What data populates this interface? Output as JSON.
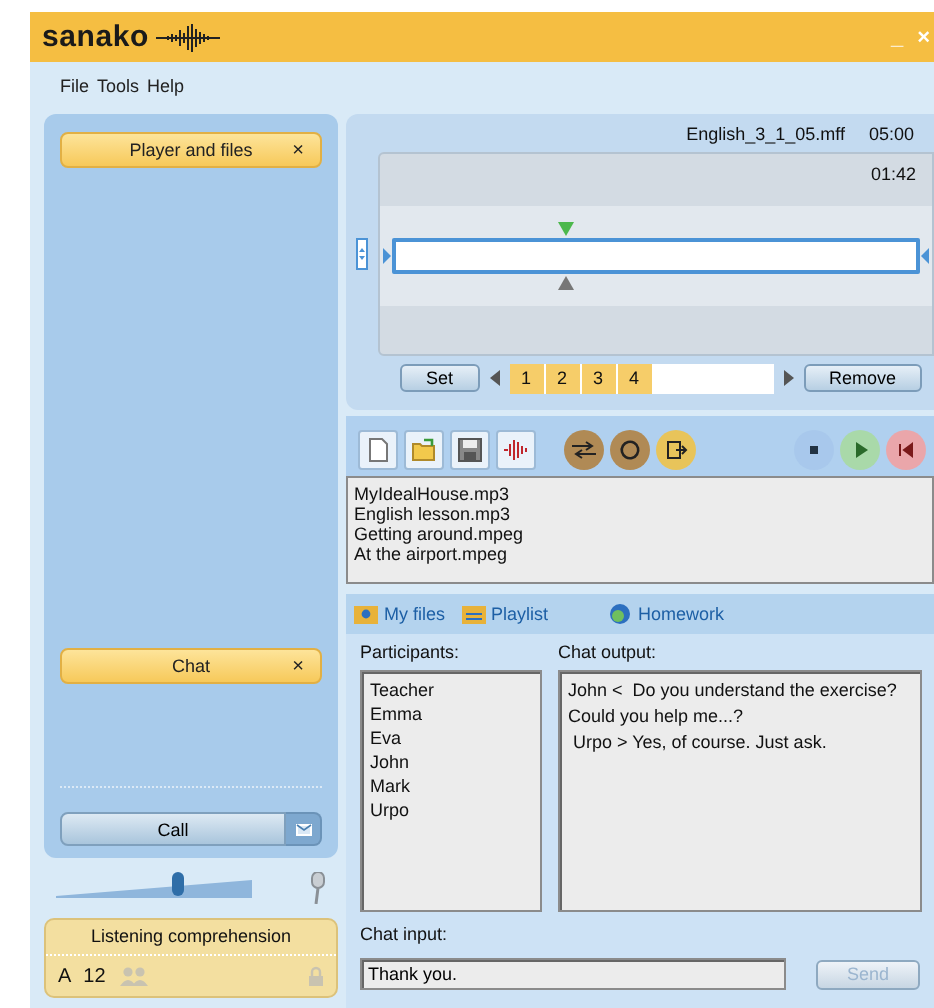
{
  "window": {
    "logo": "sanako",
    "controls": [
      "_",
      "×"
    ]
  },
  "menu": [
    "File",
    "Tools",
    "Help"
  ],
  "sidebar": {
    "tabs": [
      {
        "label": "Player and files",
        "close": "×"
      },
      {
        "label": "Chat",
        "close": "×"
      }
    ],
    "call_button": "Call",
    "volume": {
      "level": 0.62
    },
    "activity": {
      "title": "Listening comprehension",
      "group": "A",
      "count": "12"
    }
  },
  "player": {
    "file": "English_3_1_05.mff",
    "duration": "05:00",
    "position": "01:42",
    "playhead": {
      "level": 0.33
    },
    "set_button": "Set",
    "markers": [
      "1",
      "2",
      "3",
      "4"
    ],
    "remove_button": "Remove"
  },
  "files": [
    "MyIdealHouse.mp3",
    "English lesson.mp3",
    "Getting around.mpeg",
    "At the airport.mpeg"
  ],
  "file_tabs": [
    "My files",
    "Playlist",
    "Homework"
  ],
  "chat": {
    "participants_label": "Participants:",
    "participants": [
      "Teacher",
      "Emma",
      "Eva",
      "John",
      "Mark",
      "Urpo"
    ],
    "output_label": "Chat output:",
    "messages": [
      "John <  Do you understand the exercise?",
      "Could you help me...?",
      " Urpo > Yes, of course. Just ask."
    ],
    "input_label": "Chat input:",
    "input_value": "Thank you.",
    "send_button": "Send",
    "send_disabled": true
  }
}
